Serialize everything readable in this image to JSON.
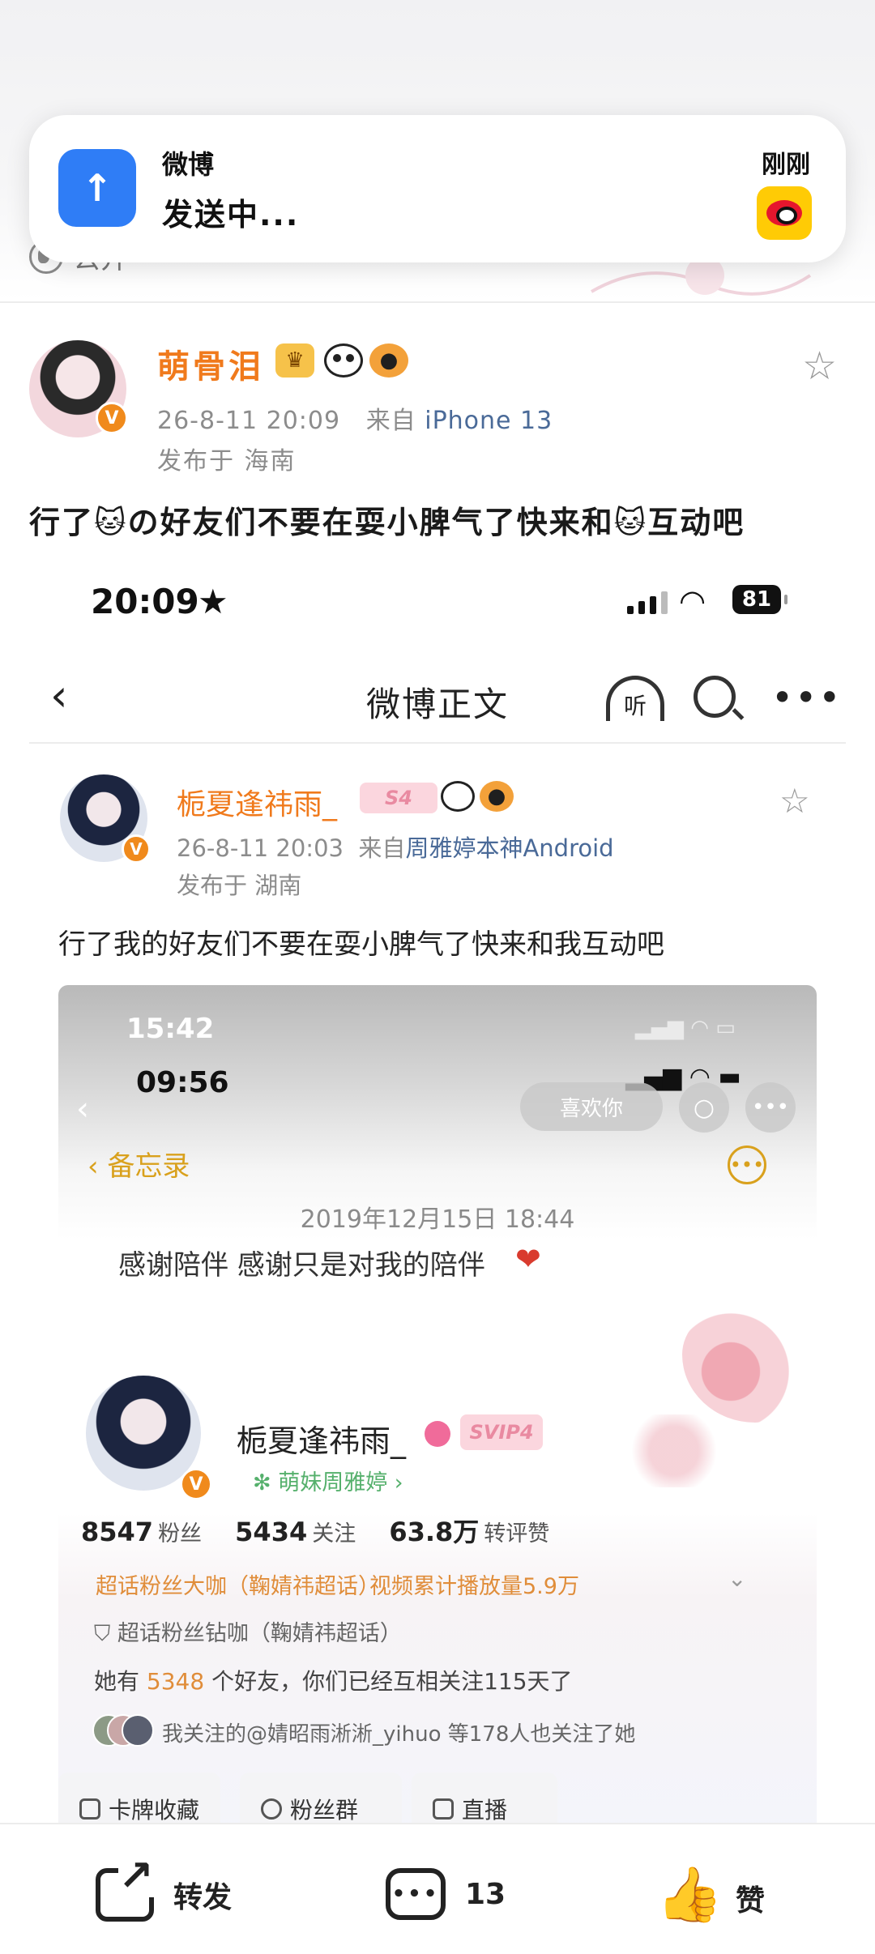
{
  "toast": {
    "app_name": "微博",
    "message": "发送中...",
    "time": "刚刚"
  },
  "public_label": "公开",
  "outer_post": {
    "author": "萌骨泪",
    "timestamp": "26-8-11 20:09",
    "source_prefix": "来自",
    "source": "iPhone 13",
    "location": "发布于 海南",
    "text": "行了🐱の好友们不要在耍小脾气了快来和🐱互动吧"
  },
  "embedded_status": {
    "time": "20:09",
    "battery": "81"
  },
  "embedded_nav": {
    "title": "微博正文",
    "listen_label": "听"
  },
  "inner_post": {
    "author": "栀夏逢祎雨_",
    "svip_label": "S4",
    "timestamp": "26-8-11 20:03",
    "source_prefix": "来自",
    "source": "周雅婷本神Android",
    "location": "发布于 湖南",
    "text": "行了我的好友们不要在耍小脾气了快来和我互动吧"
  },
  "screenshot": {
    "status_time_1": "15:42",
    "status_time_2": "09:56",
    "like_button": "喜欢你",
    "memo_back": "备忘录",
    "memo_date": "2019年12月15日 18:44",
    "memo_text": "感谢陪伴 感谢只是对我的陪伴",
    "profile_name": "栀夏逢祎雨_",
    "profile_svip": "SVIP4",
    "profile_tag": "✻ 萌妹周雅婷 ›",
    "stats": [
      {
        "num": "8547",
        "unit": "粉丝"
      },
      {
        "num": "5434",
        "unit": "关注"
      },
      {
        "num": "63.8万",
        "unit": "转评赞"
      }
    ],
    "badge_1": "超话粉丝大咖（鞠婧祎超话）",
    "badge_2": "视频累计播放量5.9万",
    "badge_3": "超话粉丝钻咖（鞠婧祎超话）",
    "friends_prefix": "她有",
    "friends_count": "5348",
    "friends_suffix": "个好友，你们已经互相关注115天了",
    "followed_by": "我关注的@婧昭雨淅淅_yihuo 等178人也关注了她",
    "cards": [
      "卡牌收藏",
      "粉丝群",
      "直播"
    ]
  },
  "actions": {
    "repost": "转发",
    "comment_count": "13",
    "like": "赞"
  },
  "colors": {
    "accent_orange": "#f07a1c",
    "link_blue": "#4a6a98",
    "toast_icon_blue": "#2f7df6",
    "memo_gold": "#d9a11d"
  }
}
